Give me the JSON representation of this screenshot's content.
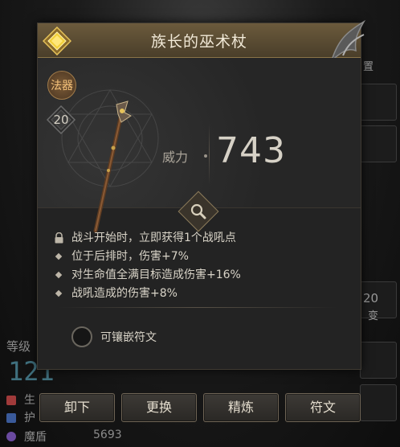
{
  "item": {
    "name": "族长的巫术杖",
    "category": "法器",
    "level": "20",
    "power_label": "威力",
    "power_value": "743"
  },
  "effects": [
    {
      "text": "战斗开始时，立即获得1个战吼点",
      "locked": true
    },
    {
      "text": "位于后排时，伤害+7%",
      "locked": false
    },
    {
      "text": "对生命值全满目标造成伤害+16%",
      "locked": false
    },
    {
      "text": "战吼造成的伤害+8%",
      "locked": false
    }
  ],
  "socket": {
    "label": "可镶嵌符文"
  },
  "actions": {
    "unequip": "卸下",
    "replace": "更换",
    "refine": "精炼",
    "rune": "符文"
  },
  "background": {
    "level_label": "等级",
    "level_value": "121",
    "stat_1_label": "生",
    "stat_2_label": "护",
    "stat_3_label": "魔盾",
    "stat_3_value": "5693",
    "right_top": "置",
    "right_mid_1": "20",
    "right_mid_2": "变"
  },
  "colors": {
    "header": "#6b5a3c",
    "card_bg": "#232323",
    "category_badge": "#f5c27a",
    "level_value": "#5fb0c8"
  }
}
